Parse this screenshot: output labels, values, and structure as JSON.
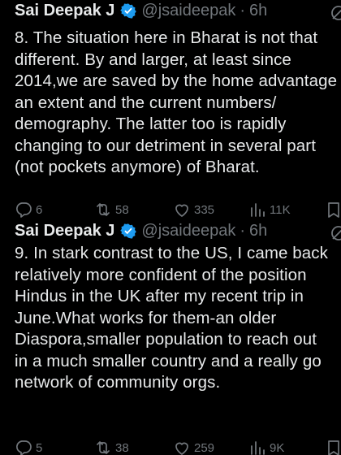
{
  "tweets": [
    {
      "author_name": "Sai Deepak J",
      "handle": "@jsaideepak",
      "separator": "·",
      "time": "6h",
      "lines": [
        "8. The situation here in Bharat is not that",
        "different. By and larger, at least since",
        "2014,we are saved by the home advantage",
        "an extent and the current numbers/",
        "demography. The latter too is rapidly",
        "changing to our detriment in several part",
        "(not pockets anymore) of Bharat."
      ],
      "replies": "6",
      "retweets": "58",
      "likes": "335",
      "views": "11K"
    },
    {
      "author_name": "Sai Deepak J",
      "handle": "@jsaideepak",
      "separator": "·",
      "time": "6h",
      "lines": [
        "9. In stark contrast to the US, I came back",
        "relatively more confident of the position",
        "Hindus in the UK after my recent trip in",
        "June.What works for them-an older",
        "Diaspora,smaller population to reach out",
        "in a much smaller country and a really go",
        "network of community orgs."
      ],
      "replies": "5",
      "retweets": "38",
      "likes": "259",
      "views": "9K"
    }
  ],
  "colors": {
    "background": "#000000",
    "text": "#e7e9ea",
    "muted": "#71767b",
    "verified": "#1d9bf0"
  },
  "icons": [
    "verified-badge-icon",
    "grok-icon",
    "reply-icon",
    "retweet-icon",
    "like-icon",
    "views-icon",
    "bookmark-icon"
  ]
}
